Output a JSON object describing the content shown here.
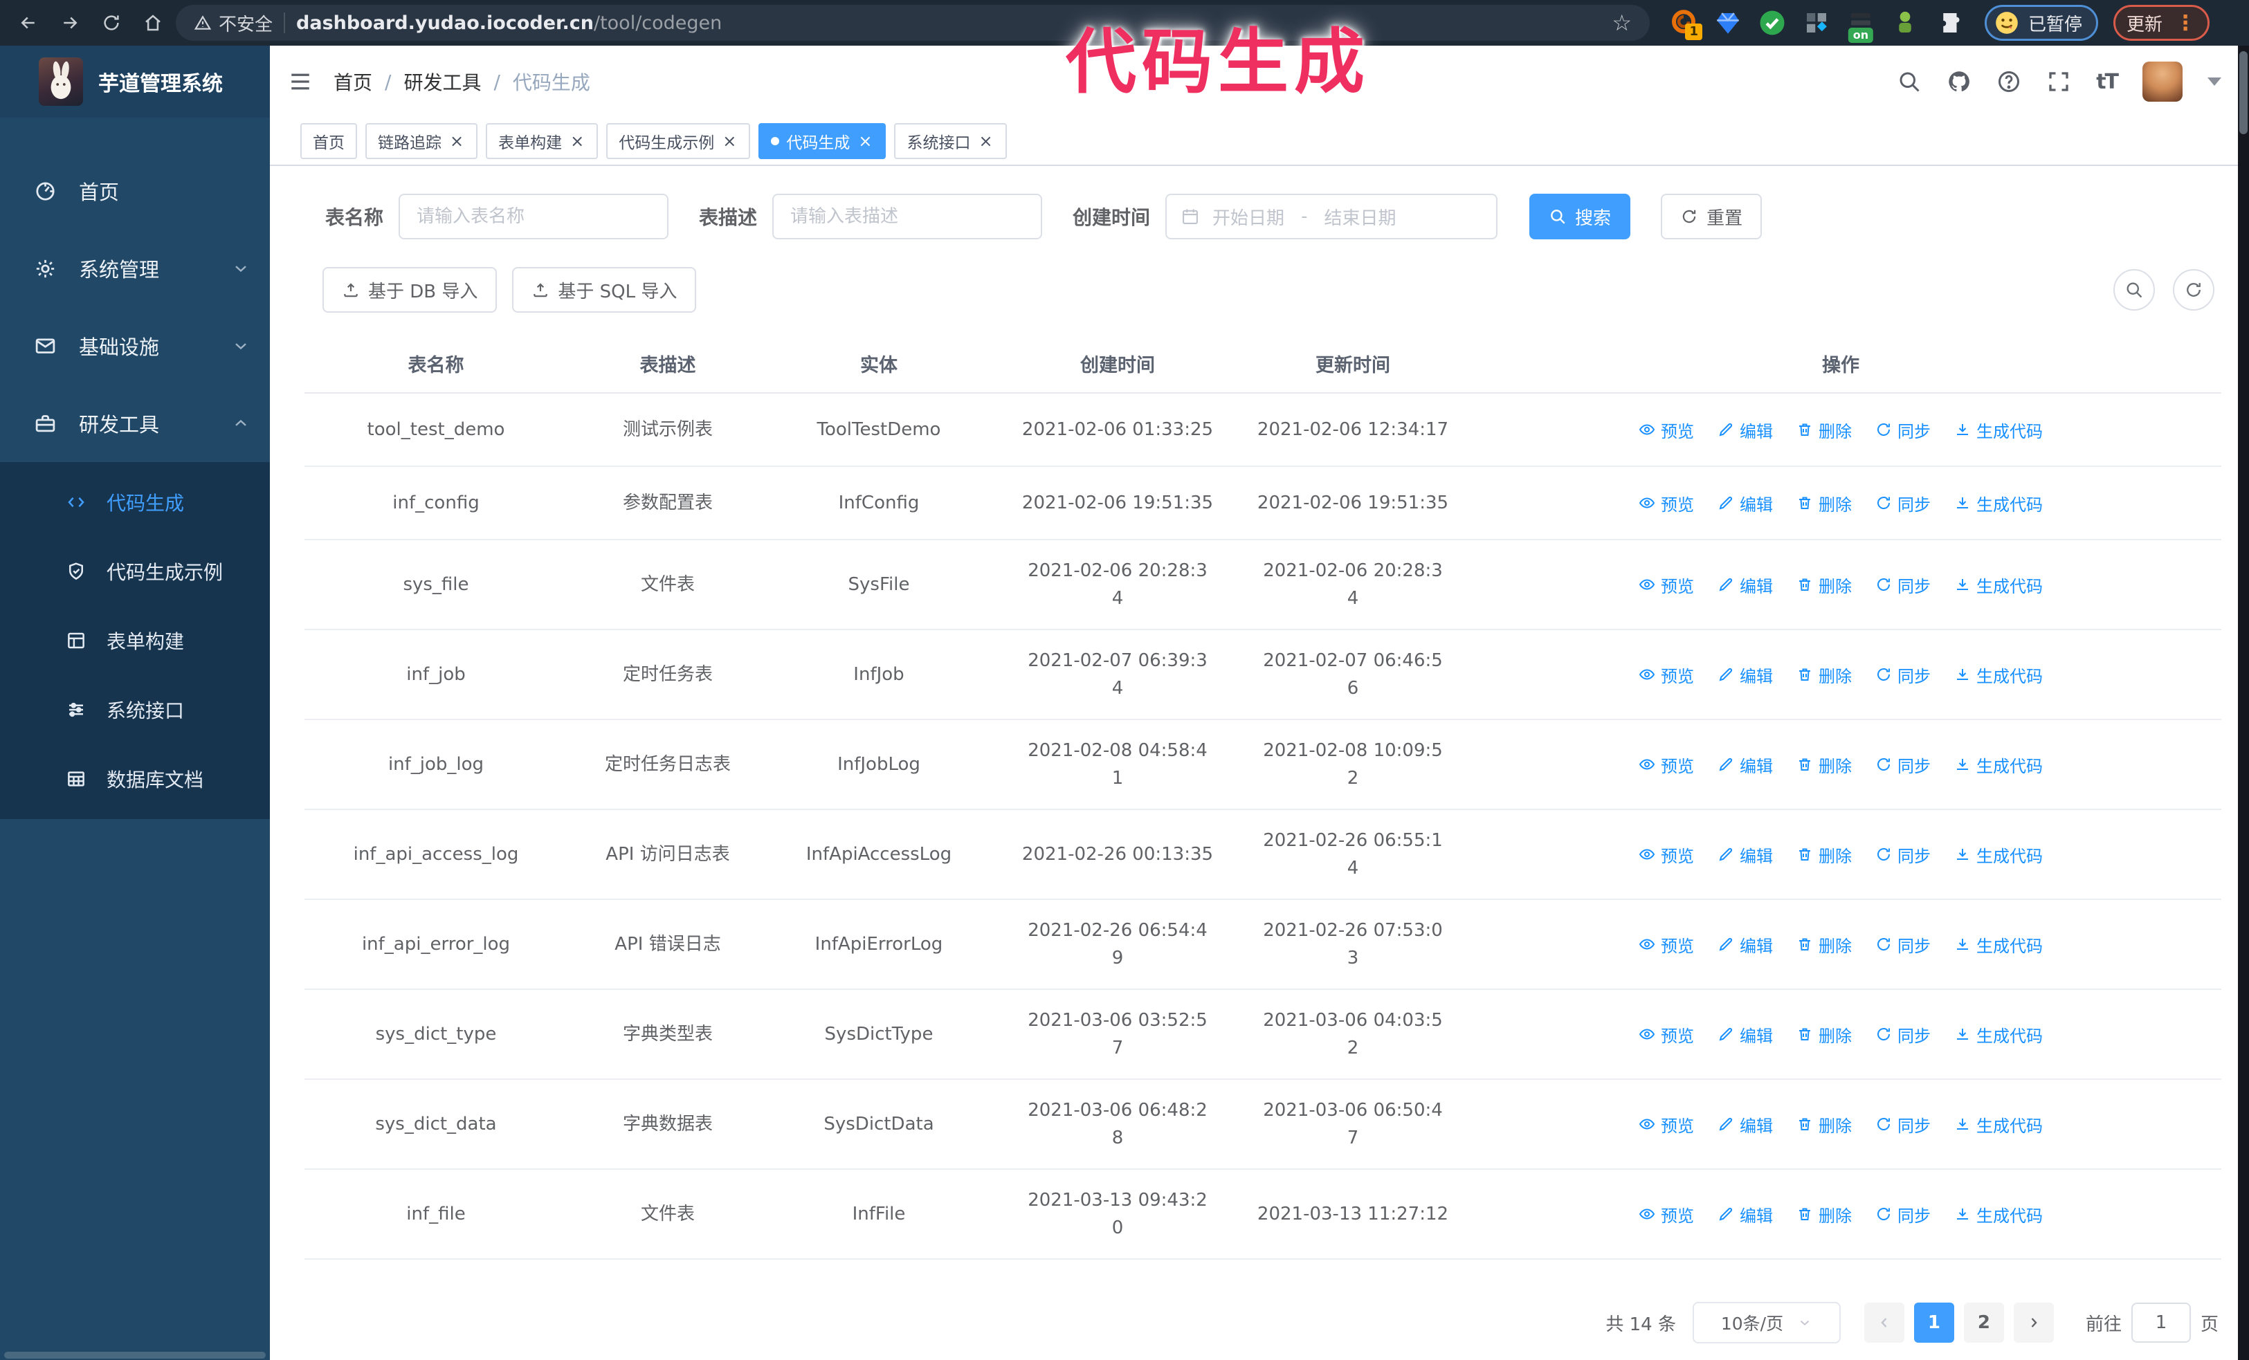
{
  "browser": {
    "warning": "不安全",
    "url_host": "dashboard.yudao.iocoder.cn",
    "url_path": "/tool/codegen",
    "ext_badge": "1",
    "on_badge": "on",
    "paused_label": "已暂停",
    "update_label": "更新"
  },
  "watermark": "代码生成",
  "app": {
    "title": "芋道管理系统"
  },
  "breadcrumb": [
    {
      "label": "首页",
      "sep": false,
      "current": false
    },
    {
      "label": "研发工具",
      "sep": true,
      "current": false
    },
    {
      "label": "代码生成",
      "sep": true,
      "current": true
    }
  ],
  "sidebar": {
    "items": [
      {
        "label": "首页",
        "icon": "dashboard-icon",
        "chevron": false,
        "expanded": false
      },
      {
        "label": "系统管理",
        "icon": "gear-icon",
        "chevron": true,
        "expanded": false
      },
      {
        "label": "基础设施",
        "icon": "infra-icon",
        "chevron": true,
        "expanded": false
      },
      {
        "label": "研发工具",
        "icon": "toolbox-icon",
        "chevron": true,
        "expanded": true
      }
    ],
    "submenu": [
      {
        "label": "代码生成",
        "icon": "code-icon",
        "active": true
      },
      {
        "label": "代码生成示例",
        "icon": "example-icon",
        "active": false
      },
      {
        "label": "表单构建",
        "icon": "form-icon",
        "active": false
      },
      {
        "label": "系统接口",
        "icon": "api-icon",
        "active": false
      },
      {
        "label": "数据库文档",
        "icon": "dbdoc-icon",
        "active": false
      }
    ]
  },
  "tabs": [
    {
      "label": "首页",
      "closable": false,
      "active": false
    },
    {
      "label": "链路追踪",
      "closable": true,
      "active": false
    },
    {
      "label": "表单构建",
      "closable": true,
      "active": false
    },
    {
      "label": "代码生成示例",
      "closable": true,
      "active": false
    },
    {
      "label": "代码生成",
      "closable": true,
      "active": true
    },
    {
      "label": "系统接口",
      "closable": true,
      "active": false
    }
  ],
  "search_form": {
    "table_name_label": "表名称",
    "table_name_placeholder": "请输入表名称",
    "table_desc_label": "表描述",
    "table_desc_placeholder": "请输入表描述",
    "create_time_label": "创建时间",
    "start_date_placeholder": "开始日期",
    "end_date_placeholder": "结束日期",
    "search_label": "搜索",
    "reset_label": "重置"
  },
  "toolbar": {
    "db_import_label": "基于 DB 导入",
    "sql_import_label": "基于 SQL 导入"
  },
  "table": {
    "columns": [
      "表名称",
      "表描述",
      "实体",
      "创建时间",
      "更新时间",
      "操作"
    ],
    "actions": [
      {
        "label": "预览",
        "icon": "eye-icon"
      },
      {
        "label": "编辑",
        "icon": "edit-icon"
      },
      {
        "label": "删除",
        "icon": "delete-icon"
      },
      {
        "label": "同步",
        "icon": "sync-icon"
      },
      {
        "label": "生成代码",
        "icon": "gencode-icon"
      }
    ],
    "rows": [
      {
        "name": "tool_test_demo",
        "desc": "测试示例表",
        "entity": "ToolTestDemo",
        "created": "2021-02-06 01:33:25",
        "updated": "2021-02-06 12:34:17",
        "created_wrap": false,
        "updated_wrap": false
      },
      {
        "name": "inf_config",
        "desc": "参数配置表",
        "entity": "InfConfig",
        "created": "2021-02-06 19:51:35",
        "updated": "2021-02-06 19:51:35",
        "created_wrap": false,
        "updated_wrap": false
      },
      {
        "name": "sys_file",
        "desc": "文件表",
        "entity": "SysFile",
        "created": "2021-02-06 20:28:34",
        "updated": "2021-02-06 20:28:34",
        "created_wrap": true,
        "updated_wrap": true
      },
      {
        "name": "inf_job",
        "desc": "定时任务表",
        "entity": "InfJob",
        "created": "2021-02-07 06:39:34",
        "updated": "2021-02-07 06:46:56",
        "created_wrap": true,
        "updated_wrap": true
      },
      {
        "name": "inf_job_log",
        "desc": "定时任务日志表",
        "entity": "InfJobLog",
        "created": "2021-02-08 04:58:41",
        "updated": "2021-02-08 10:09:52",
        "created_wrap": true,
        "updated_wrap": true
      },
      {
        "name": "inf_api_access_log",
        "desc": "API 访问日志表",
        "entity": "InfApiAccessLog",
        "created": "2021-02-26 00:13:35",
        "updated": "2021-02-26 06:55:14",
        "created_wrap": false,
        "updated_wrap": true
      },
      {
        "name": "inf_api_error_log",
        "desc": "API 错误日志",
        "entity": "InfApiErrorLog",
        "created": "2021-02-26 06:54:49",
        "updated": "2021-02-26 07:53:03",
        "created_wrap": true,
        "updated_wrap": true
      },
      {
        "name": "sys_dict_type",
        "desc": "字典类型表",
        "entity": "SysDictType",
        "created": "2021-03-06 03:52:57",
        "updated": "2021-03-06 04:03:52",
        "created_wrap": true,
        "updated_wrap": true
      },
      {
        "name": "sys_dict_data",
        "desc": "字典数据表",
        "entity": "SysDictData",
        "created": "2021-03-06 06:48:28",
        "updated": "2021-03-06 06:50:47",
        "created_wrap": true,
        "updated_wrap": true
      },
      {
        "name": "inf_file",
        "desc": "文件表",
        "entity": "InfFile",
        "created": "2021-03-13 09:43:20",
        "updated": "2021-03-13 11:27:12",
        "created_wrap": true,
        "updated_wrap": false
      }
    ]
  },
  "pagination": {
    "total_text": "共 14 条",
    "page_size": "10条/页",
    "pages": [
      {
        "label": "1",
        "active": true
      },
      {
        "label": "2",
        "active": false
      }
    ],
    "goto_label": "前往",
    "goto_value": "1",
    "page_suffix": "页"
  },
  "glyphs": {
    "close": "×",
    "star": "☆",
    "dash": "-",
    "fontsize": "tT"
  },
  "colors": {
    "primary": "#409eff",
    "link": "#1890ff",
    "watermark": "#ee2f5f",
    "sidebar_bg": "#214866",
    "submenu_bg": "#17344f",
    "browser_bar_bg": "#1e2936"
  }
}
